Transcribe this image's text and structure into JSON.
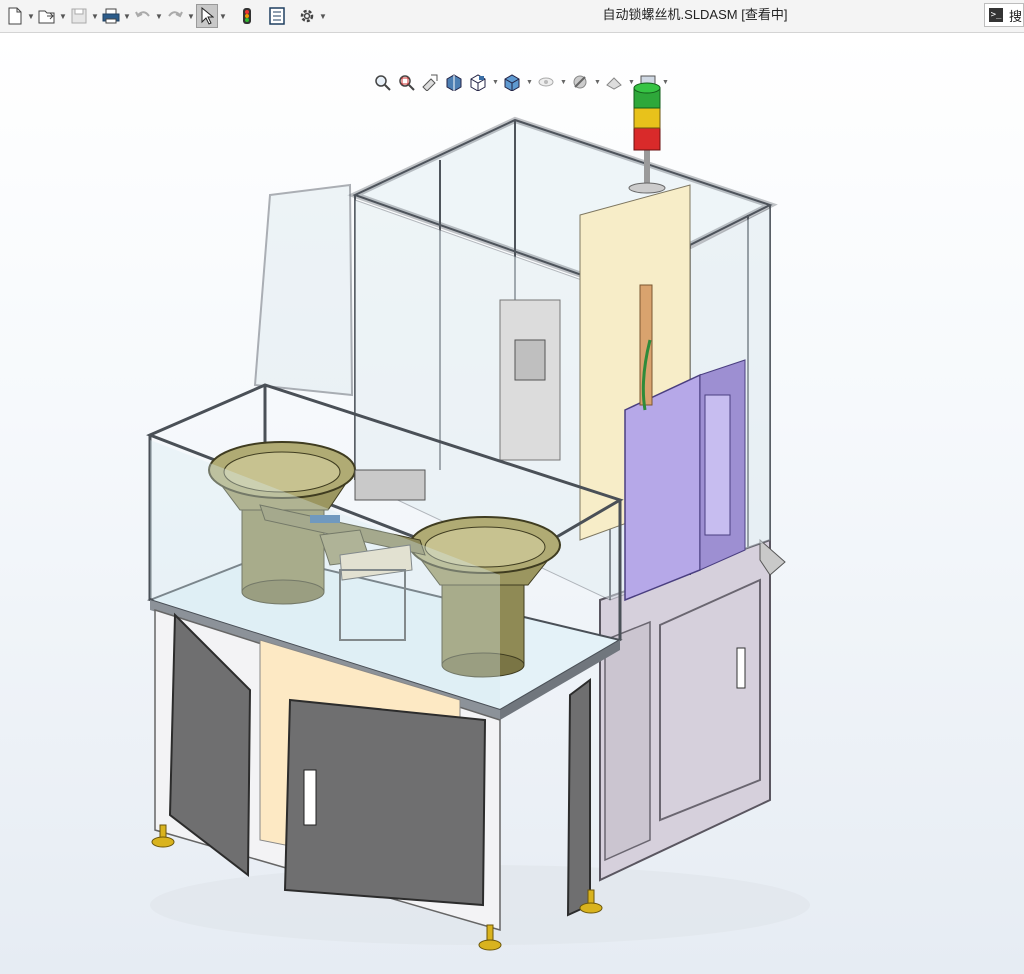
{
  "window": {
    "title": "自动锁螺丝机.SLDASM [查看中]"
  },
  "toolbar": {
    "buttons": [
      {
        "name": "new-document-icon",
        "has_menu": true
      },
      {
        "name": "open-file-icon",
        "has_menu": true
      },
      {
        "name": "save-icon",
        "has_menu": true
      },
      {
        "name": "print-icon",
        "has_menu": true
      },
      {
        "name": "undo-icon",
        "has_menu": true
      },
      {
        "name": "redo-icon",
        "has_menu": true
      },
      {
        "name": "select-cursor-icon",
        "has_menu": true,
        "active": true
      },
      {
        "name": "traffic-light-icon",
        "has_menu": false
      },
      {
        "name": "file-properties-icon",
        "has_menu": false
      },
      {
        "name": "options-gear-icon",
        "has_menu": true
      }
    ]
  },
  "search": {
    "label": "搜"
  },
  "heads_up_toolbar": {
    "buttons": [
      "zoom-to-fit-icon",
      "zoom-to-area-icon",
      "previous-view-icon",
      "section-view-icon",
      "view-orientation-icon",
      "display-style-icon",
      "hide-show-items-icon",
      "edit-appearance-icon",
      "apply-scene-icon",
      "view-settings-icon"
    ]
  },
  "colors": {
    "frame": "#b9bfc6",
    "frame_dark": "#5f656c",
    "glass": "#cfe6f0",
    "cabinet": "#d9d3df",
    "door": "#6f6f70",
    "bowl": "#8f8a55",
    "plate": "#e4f2f8",
    "purple_panel": "#b6a8e8",
    "cream_panel": "#f7edc8",
    "light_green": "#2ea83a",
    "light_yellow": "#e8c21b",
    "light_red": "#d92a2a",
    "foot": "#d9b31e"
  }
}
